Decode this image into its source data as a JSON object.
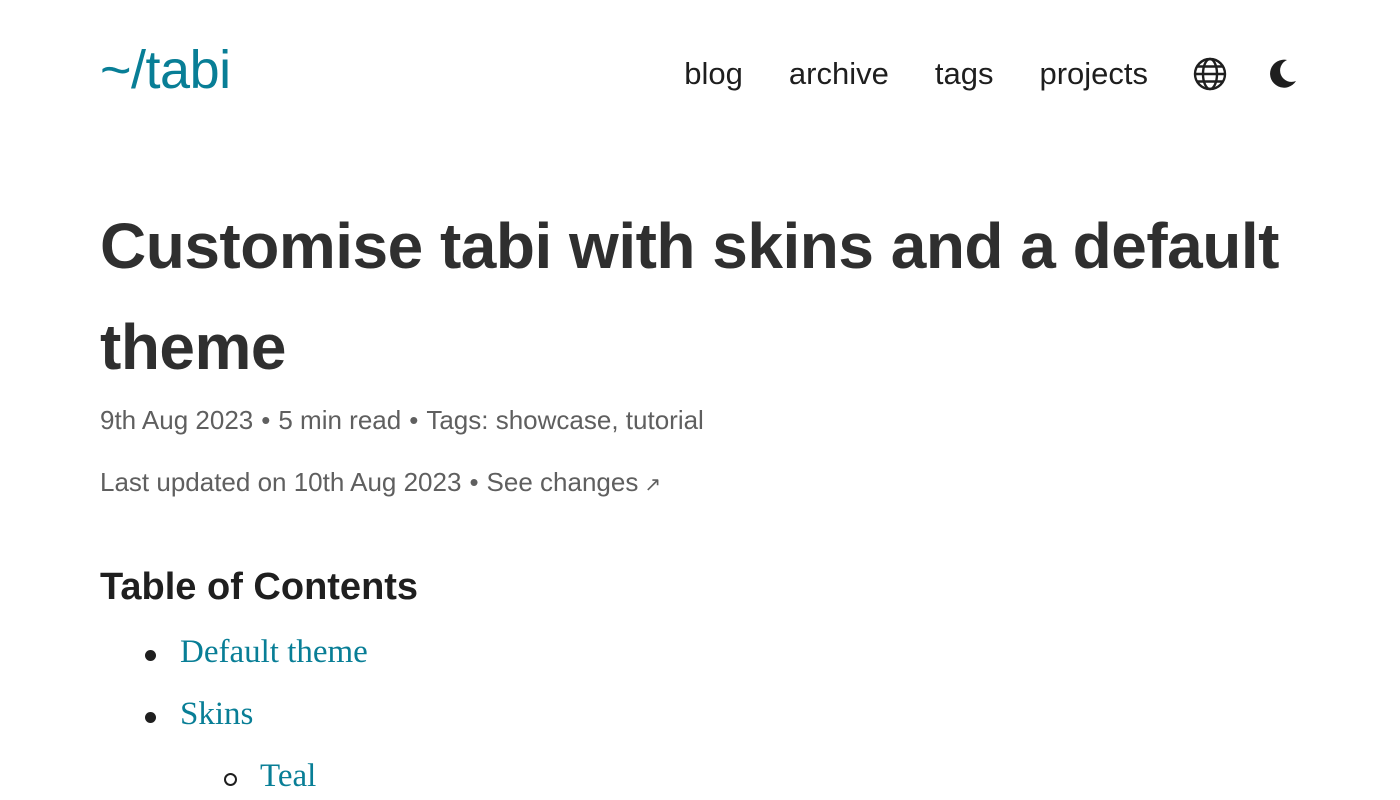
{
  "header": {
    "logo": "~/tabi",
    "nav": [
      "blog",
      "archive",
      "tags",
      "projects"
    ],
    "icons": {
      "language": "globe-icon",
      "theme": "moon-icon"
    }
  },
  "article": {
    "title": "Customise tabi with skins and a default theme",
    "date": "9th Aug 2023",
    "read_time": "5 min read",
    "tags_label": "Tags:",
    "tags": [
      "showcase",
      "tutorial"
    ],
    "updated": "Last updated on 10th Aug 2023",
    "changes": "See changes"
  },
  "toc": {
    "heading": "Table of Contents",
    "items": [
      "Default theme",
      "Skins"
    ],
    "subitems": [
      "Teal"
    ]
  },
  "colors": {
    "accent": "#087e96",
    "text": "#2f2f2f",
    "meta": "#5f5f5f"
  }
}
